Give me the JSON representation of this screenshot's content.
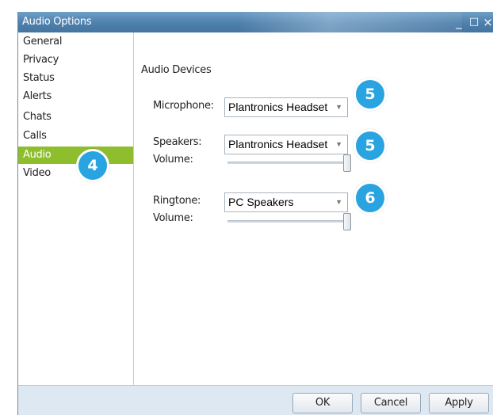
{
  "window": {
    "title": "Audio Options",
    "controls": {
      "minimize": "_",
      "maximize": "□",
      "close": "×"
    }
  },
  "sidebar": {
    "items": [
      {
        "label": "General"
      },
      {
        "label": "Privacy"
      },
      {
        "label": "Status"
      },
      {
        "label": "Alerts"
      },
      {
        "label": "Chats"
      },
      {
        "label": "Calls"
      },
      {
        "label": "Audio",
        "selected": true
      },
      {
        "label": "Video"
      }
    ]
  },
  "main": {
    "section_title": "Audio Devices",
    "microphone": {
      "label": "Microphone:",
      "value": "Plantronics Headset"
    },
    "speakers": {
      "label": "Speakers:",
      "value": "Plantronics Headset",
      "volume_label": "Volume:",
      "volume_level": 1.0
    },
    "ringtone": {
      "label": "Ringtone:",
      "value": "PC Speakers",
      "volume_label": "Volume:",
      "volume_level": 1.0
    }
  },
  "callouts": {
    "audio": "4",
    "microphone": "5",
    "speakers": "5",
    "ringtone": "6"
  },
  "footer": {
    "ok": "OK",
    "cancel": "Cancel",
    "apply": "Apply"
  },
  "colors": {
    "accent_selected": "#8ebd2e",
    "callout": "#2aa4e0",
    "titlebar": "#4e80ad"
  }
}
